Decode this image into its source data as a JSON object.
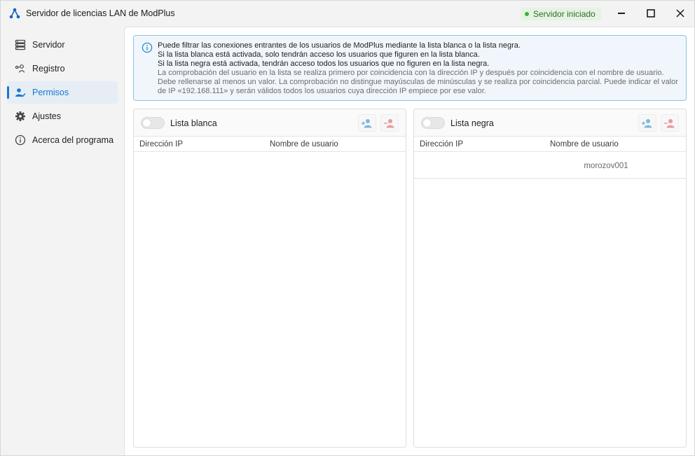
{
  "window": {
    "title": "Servidor de licencias LAN de ModPlus",
    "status": "Servidor iniciado",
    "status_color": "#3bb13a"
  },
  "sidebar": {
    "items": [
      {
        "label": "Servidor",
        "icon": "server-icon",
        "active": false
      },
      {
        "label": "Registro",
        "icon": "log-icon",
        "active": false
      },
      {
        "label": "Permisos",
        "icon": "user-check-icon",
        "active": true
      },
      {
        "label": "Ajustes",
        "icon": "gear-icon",
        "active": false
      },
      {
        "label": "Acerca del programa",
        "icon": "info-icon",
        "active": false
      }
    ]
  },
  "info": {
    "lines": [
      "Puede filtrar las conexiones entrantes de los usuarios de ModPlus mediante la lista blanca o la lista negra.",
      "Si la lista blanca está activada, solo tendrán acceso los usuarios que figuren en la lista blanca.",
      "Si la lista negra está activada, tendrán acceso todos los usuarios que no figuren en la lista negra."
    ],
    "note": "La comprobación del usuario en la lista se realiza primero por coincidencia con la dirección IP y después por coincidencia con el nombre de usuario. Debe rellenarse al menos un valor. La comprobación no distingue mayúsculas de minúsculas y se realiza por coincidencia parcial. Puede indicar el valor de IP «192.168.111» y serán válidos todos los usuarios cuya dirección IP empiece por ese valor."
  },
  "whitelist": {
    "title": "Lista blanca",
    "enabled": false,
    "columns": [
      "Dirección IP",
      "Nombre de usuario"
    ],
    "rows": []
  },
  "blacklist": {
    "title": "Lista negra",
    "enabled": false,
    "columns": [
      "Dirección IP",
      "Nombre de usuario"
    ],
    "rows": [
      {
        "ip": "",
        "user": "morozov001"
      }
    ]
  },
  "colors": {
    "accent": "#1976d2",
    "add_icon": "#7fb8dd",
    "remove_icon": "#e79a9a",
    "info_border": "#8ec4e4"
  }
}
